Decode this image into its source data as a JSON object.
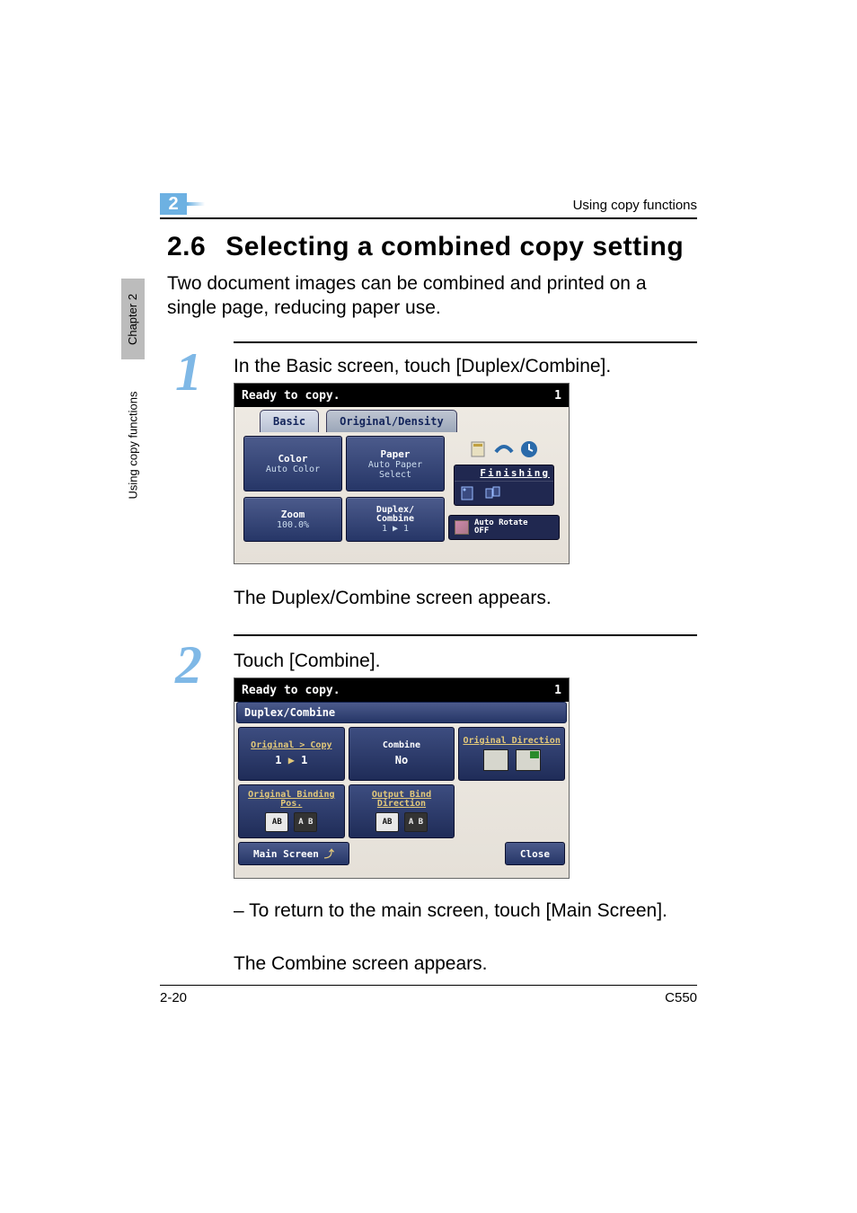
{
  "header": {
    "section_number": "2",
    "running_title": "Using copy functions"
  },
  "title": {
    "number": "2.6",
    "text": "Selecting a combined copy setting"
  },
  "intro": "Two document images can be combined and printed on a single page, reducing paper use.",
  "side": {
    "chapter": "Chapter 2",
    "using": "Using copy functions"
  },
  "step1": {
    "num": "1",
    "text": "In the Basic screen, touch [Duplex/Combine].",
    "after": "The Duplex/Combine screen appears."
  },
  "step2": {
    "num": "2",
    "text": "Touch [Combine].",
    "note": "– To return to the main screen, touch [Main Screen].",
    "after": "The Combine screen appears."
  },
  "footer": {
    "left": "2-20",
    "right": "C550"
  },
  "shot1": {
    "status": "Ready to copy.",
    "count": "1",
    "tabs": {
      "basic": "Basic",
      "orig_density": "Original/Density"
    },
    "color": {
      "title": "Color",
      "value": "Auto Color"
    },
    "paper": {
      "title": "Paper",
      "value_l1": "Auto Paper",
      "value_l2": "Select"
    },
    "zoom": {
      "title": "Zoom",
      "value": "100.0%"
    },
    "duplex": {
      "title_l1": "Duplex/",
      "title_l2": "Combine",
      "value": "1 ▶ 1"
    },
    "finishing": "Finishing",
    "autorotate_l1": "Auto Rotate",
    "autorotate_l2": "OFF"
  },
  "shot2": {
    "status": "Ready to copy.",
    "count": "1",
    "subtitle": "Duplex/Combine",
    "orig_copy": {
      "title": "Original > Copy",
      "value": "1 ▶ 1"
    },
    "combine": {
      "title": "Combine",
      "value": "No"
    },
    "orig_dir": {
      "title": "Original Direction"
    },
    "orig_bind": {
      "title": "Original Binding Pos."
    },
    "out_bind": {
      "title": "Output Bind Direction"
    },
    "ab1": "AB",
    "ab2": "A B",
    "main_screen": "Main Screen",
    "close": "Close"
  }
}
